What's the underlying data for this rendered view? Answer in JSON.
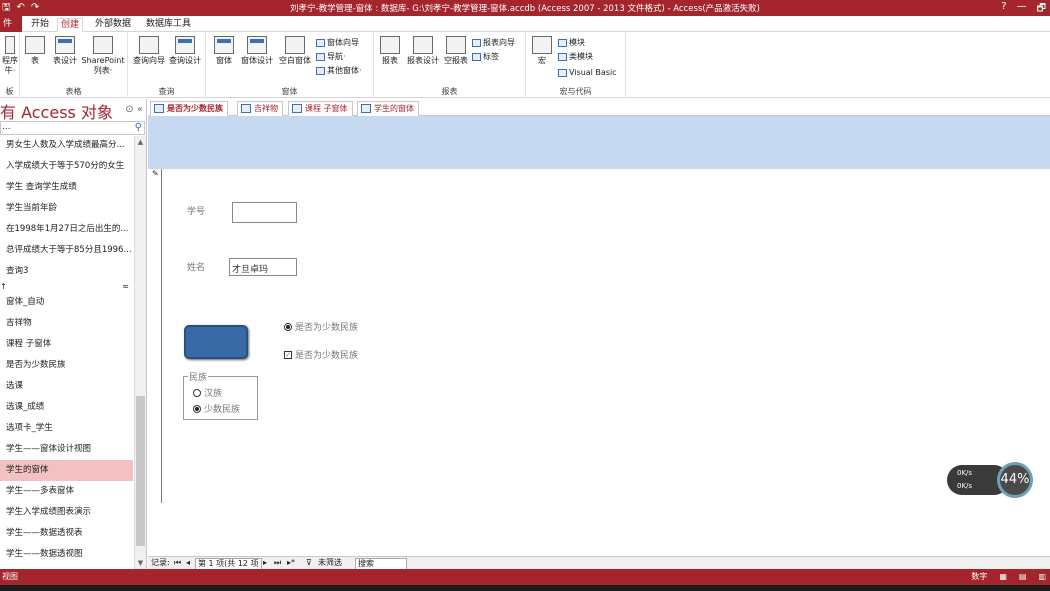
{
  "window": {
    "title": "刘孝宁-教学管理-窗体 : 数据库- G:\\刘孝宁-教学管理-窗体.accdb (Access 2007 - 2013 文件格式) - Access(产品激活失败)",
    "help": "?",
    "minimize": "—",
    "restore": "🗗"
  },
  "ribbon_tabs": [
    "件",
    "开始",
    "创建",
    "外部数据",
    "数据库工具"
  ],
  "ribbon": {
    "groups": [
      "板",
      "表格",
      "查询",
      "窗体",
      "报表",
      "宏与代码"
    ],
    "buttons": {
      "app_part": "程序",
      "app_part2": "牛·",
      "table": "表",
      "table_design": "表设计",
      "sharepoint": "SharePoint",
      "sharepoint2": "列表·",
      "query_wizard": "查询向导",
      "query_design": "查询设计",
      "form": "窗体",
      "form_design": "窗体设计",
      "blank_form": "空白窗体",
      "form_wizard": "窗体向导",
      "navigation": "导航·",
      "more_forms": "其他窗体·",
      "report": "报表",
      "report_design": "报表设计",
      "blank_report": "空报表",
      "report_wizard": "报表向导",
      "labels": "标签",
      "macro": "宏",
      "module": "模块",
      "class_module": "类模块",
      "visual_basic": "Visual Basic"
    }
  },
  "nav": {
    "title": "有 Access 对象",
    "search_placeholder": "...",
    "queries": [
      "男女生人数及入学成绩最高分...",
      "入学成绩大于等于570分的女生",
      "学生 查询学生成绩",
      "学生当前年龄",
      "在1998年1月27日之后出生的...",
      "总评成绩大于等于85分且1996...",
      "查询3"
    ],
    "forms_header": "↑",
    "forms": [
      "窗体_自动",
      "吉祥物",
      "课程 子窗体",
      "是否为少数民族",
      "选课",
      "选课_成绩",
      "选项卡_学生",
      "学生——窗体设计视图",
      "学生的窗体",
      "学生——多表窗体",
      "学生入学成绩图表演示",
      "学生——数据透视表",
      "学生——数据透视图"
    ],
    "selected": "学生的窗体"
  },
  "doc_tabs": [
    "是否为少数民族",
    "吉祥物",
    "课程 子窗体",
    "学生的窗体"
  ],
  "form": {
    "label_id": "学号",
    "value_id": "",
    "label_name": "姓名",
    "value_name": "才旦卓玛",
    "option_radio": "是否为少数民族",
    "option_check": "是否为少数民族",
    "frame_title": "民族",
    "frame_opt1": "汉族",
    "frame_opt2": "少数民族"
  },
  "record_nav": {
    "label": "记录:",
    "first": "⏮",
    "prev": "◂",
    "position": "第 1 项(共 12 项",
    "next": "▸",
    "last": "⏭",
    "new": "▸*",
    "filter": "未筛选",
    "search": "搜索"
  },
  "status": {
    "left": "视图",
    "numlock": "数字"
  },
  "net_widget": {
    "up": "0K/s",
    "down": "0K/s",
    "percent": "44%"
  }
}
